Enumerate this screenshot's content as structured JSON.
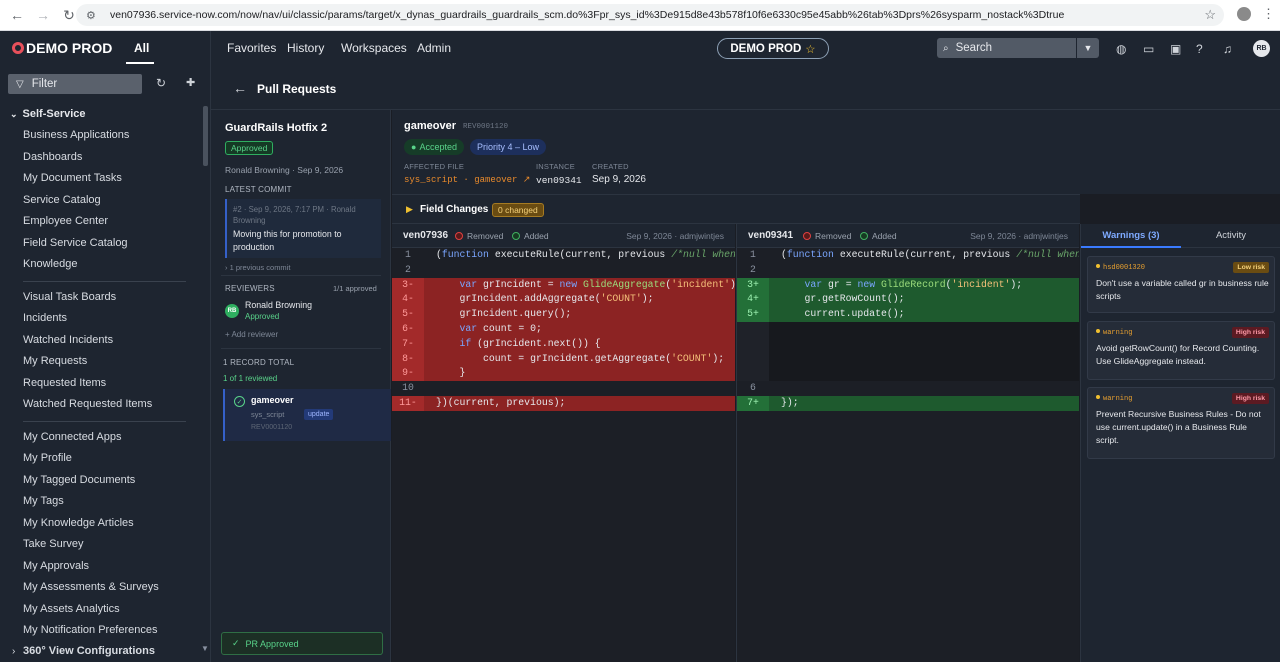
{
  "browser": {
    "url": "ven07936.service-now.com/now/nav/ui/classic/params/target/x_dynas_guardrails_guardrails_scm.do%3Fpr_sys_id%3De915d8e43b578f10f6e6330c95e45abb%26tab%3Dprs%26sysparm_nostack%3Dtrue"
  },
  "header": {
    "logo": "DEMO PROD",
    "all_tab": "All",
    "nav": [
      "Favorites",
      "History",
      "Workspaces",
      "Admin"
    ],
    "instance_pill": "DEMO PROD",
    "search_placeholder": "Search",
    "avatar_initials": "RB"
  },
  "sidebar": {
    "filter_placeholder": "Filter",
    "section_title": "Self-Service",
    "groups": [
      [
        "Business Applications",
        "Dashboards",
        "My Document Tasks",
        "Service Catalog",
        "Employee Center",
        "Field Service Catalog",
        "Knowledge"
      ],
      [
        "Visual Task Boards",
        "Incidents",
        "Watched Incidents",
        "My Requests",
        "Requested Items",
        "Watched Requested Items"
      ],
      [
        "My Connected Apps",
        "My Profile",
        "My Tagged Documents",
        "My Tags",
        "My Knowledge Articles",
        "Take Survey",
        "My Approvals",
        "My Assessments & Surveys",
        "My Assets Analytics",
        "My Notification Preferences",
        "360° View Configurations"
      ]
    ]
  },
  "page": {
    "title": "Pull Requests"
  },
  "pr": {
    "title": "GuardRails Hotfix 2",
    "status": "Approved",
    "meta": "Ronald Browning · Sep 9, 2026",
    "latest_commit_label": "LATEST COMMIT",
    "commit_meta": "#2 · Sep 9, 2026, 7:17 PM · Ronald Browning",
    "commit_message": "Moving this for promotion to production",
    "previous_commits": "› 1 previous commit",
    "reviewers_label": "REVIEWERS",
    "reviewers_count": "1/1 approved",
    "reviewer_initials": "RB",
    "reviewer_name": "Ronald Browning",
    "reviewer_status": "Approved",
    "add_reviewer": "+ Add reviewer",
    "record_total": "1 RECORD TOTAL",
    "reviewed": "1 of 1 reviewed",
    "record": {
      "name": "gameover",
      "table": "sys_script",
      "action": "update",
      "id": "REV0001120"
    },
    "approved_button": "PR Approved"
  },
  "record_header": {
    "name": "gameover",
    "id": "REV0001120",
    "status": "Accepted",
    "priority": "Priority 4 – Low",
    "affected_file_label": "AFFECTED FILE",
    "affected_file": "sys_script · gameover ↗",
    "instance_label": "INSTANCE",
    "instance": "ven09341",
    "created_label": "CREATED",
    "created": "Sep 9, 2026",
    "field_changes_label": "Field Changes",
    "field_changes_badge": "0 changed"
  },
  "diff": {
    "left": {
      "instance": "ven07936",
      "removed_label": "Removed",
      "added_label": "Added",
      "meta": "Sep 9, 2026 · admjwintjes"
    },
    "right": {
      "instance": "ven09341",
      "removed_label": "Removed",
      "added_label": "Added",
      "meta": "Sep 9, 2026 · admjwintjes"
    }
  },
  "warnings_panel": {
    "tab_warnings": "Warnings (3)",
    "tab_activity": "Activity",
    "cards": [
      {
        "source": "hsd0001320",
        "risk": "Low risk",
        "message": "Don't use a variable called gr in business rule scripts"
      },
      {
        "source": "warning",
        "risk": "High risk",
        "message": "Avoid getRowCount() for Record Counting. Use GlideAggregate instead."
      },
      {
        "source": "warning",
        "risk": "High risk",
        "message": "Prevent Recursive Business Rules - Do not use current.update() in a Business Rule script."
      }
    ]
  }
}
